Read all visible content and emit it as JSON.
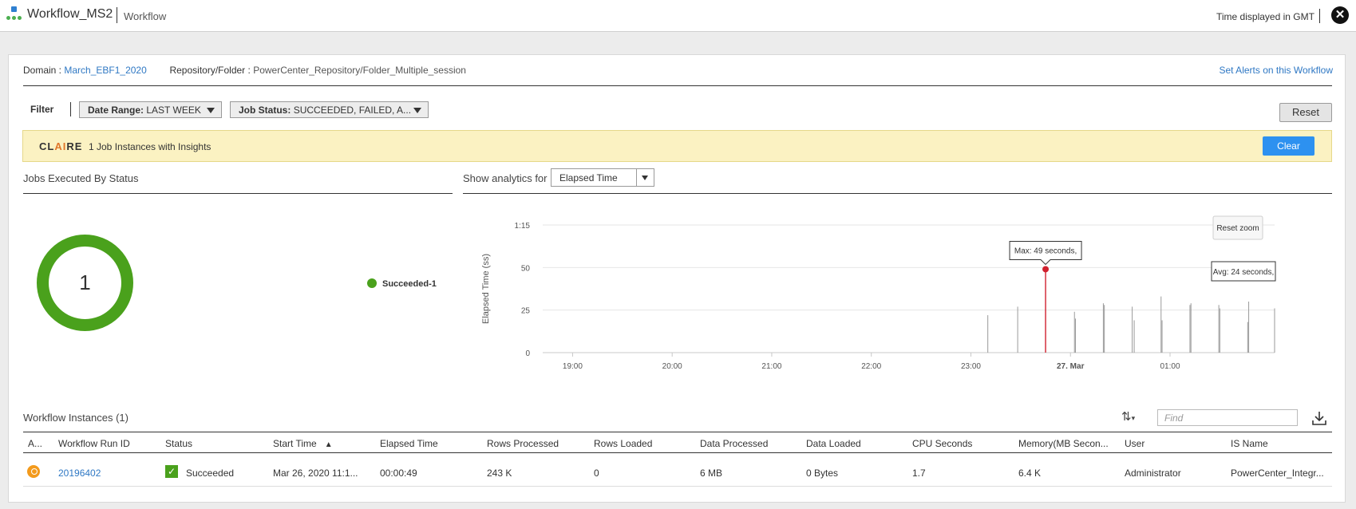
{
  "header": {
    "title": "Workflow_MS2",
    "subtitle": "Workflow",
    "timezone": "Time displayed in GMT"
  },
  "meta": {
    "domain_label": "Domain :",
    "domain_value": "March_EBF1_2020",
    "repo_label": "Repository/Folder :",
    "repo_value": "PowerCenter_Repository/Folder_Multiple_session",
    "alerts_link": "Set Alerts on this Workflow"
  },
  "filter": {
    "label": "Filter",
    "date_range_label": "Date Range:",
    "date_range_value": "LAST WEEK",
    "job_status_label": "Job Status:",
    "job_status_value": "SUCCEEDED, FAILED, A...",
    "reset": "Reset"
  },
  "claire": {
    "logo_pre": "CL",
    "logo_ai": "AI",
    "logo_post": "RE",
    "text": "1 Job Instances with Insights",
    "clear": "Clear"
  },
  "status_panel": {
    "title": "Jobs Executed By Status",
    "total": "1",
    "legend": "Succeeded-1"
  },
  "analytics": {
    "label": "Show analytics for",
    "selected": "Elapsed Time"
  },
  "chart_data": {
    "type": "bar",
    "ylabel": "Elapsed Time (ss)",
    "yticks": [
      "0",
      "25",
      "50",
      "1:15"
    ],
    "ylim": [
      0,
      75
    ],
    "xticks": [
      "19:00",
      "20:00",
      "21:00",
      "22:00",
      "23:00",
      "27. Mar",
      "01:00"
    ],
    "xlim": [
      18.2,
      25.55
    ],
    "bars": [
      {
        "x": 22.67,
        "y": 22
      },
      {
        "x": 22.97,
        "y": 27
      },
      {
        "x": 23.25,
        "y": 49
      },
      {
        "x": 23.54,
        "y": 24
      },
      {
        "x": 23.55,
        "y": 20
      },
      {
        "x": 23.83,
        "y": 29
      },
      {
        "x": 23.84,
        "y": 28
      },
      {
        "x": 24.12,
        "y": 27
      },
      {
        "x": 24.14,
        "y": 19
      },
      {
        "x": 24.41,
        "y": 33
      },
      {
        "x": 24.42,
        "y": 19
      },
      {
        "x": 24.7,
        "y": 28
      },
      {
        "x": 24.71,
        "y": 29
      },
      {
        "x": 24.99,
        "y": 28
      },
      {
        "x": 25.0,
        "y": 26
      },
      {
        "x": 25.28,
        "y": 18
      },
      {
        "x": 25.29,
        "y": 30
      },
      {
        "x": 25.55,
        "y": 26
      }
    ],
    "highlight_index": 2,
    "max_tooltip": "Max: 49 seconds,",
    "avg_tooltip": "Avg: 24 seconds,",
    "reset_zoom": "Reset zoom",
    "grid": true
  },
  "instances": {
    "title": "Workflow Instances (1)",
    "find_placeholder": "Find",
    "columns": [
      "A...",
      "Workflow Run ID",
      "Status",
      "Start Time",
      "Elapsed Time",
      "Rows Processed",
      "Rows Loaded",
      "Data Processed",
      "Data Loaded",
      "CPU Seconds",
      "Memory(MB Secon...",
      "User",
      "IS Name"
    ],
    "rows": [
      {
        "run_id": "20196402",
        "status": "Succeeded",
        "start_time": "Mar 26, 2020 11:1...",
        "elapsed": "00:00:49",
        "rows_processed": "243 K",
        "rows_loaded": "0",
        "data_processed": "6 MB",
        "data_loaded": "0 Bytes",
        "cpu_seconds": "1.7",
        "memory": "6.4 K",
        "user": "Administrator",
        "is_name": "PowerCenter_Integr..."
      }
    ]
  },
  "colors": {
    "accent": "#2d91f0",
    "link": "#2f78c4",
    "success": "#4aa11c",
    "highlight": "#d0202e",
    "claire_bg": "#fbf2c2"
  }
}
